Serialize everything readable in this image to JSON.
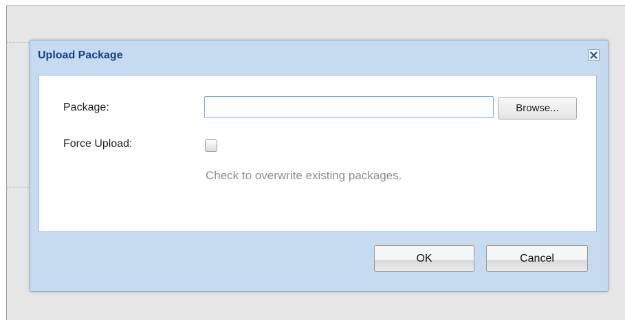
{
  "dialog": {
    "title": "Upload Package",
    "close_icon": "close-icon"
  },
  "form": {
    "package_label": "Package:",
    "package_value": "",
    "browse_label": "Browse...",
    "force_upload_label": "Force Upload:",
    "force_upload_checked": false,
    "force_upload_hint": "Check to overwrite existing packages."
  },
  "footer": {
    "ok_label": "OK",
    "cancel_label": "Cancel"
  },
  "colors": {
    "title": "#15428b",
    "dialog_bg": "#c6dbef",
    "hint": "#8c8c8c"
  }
}
